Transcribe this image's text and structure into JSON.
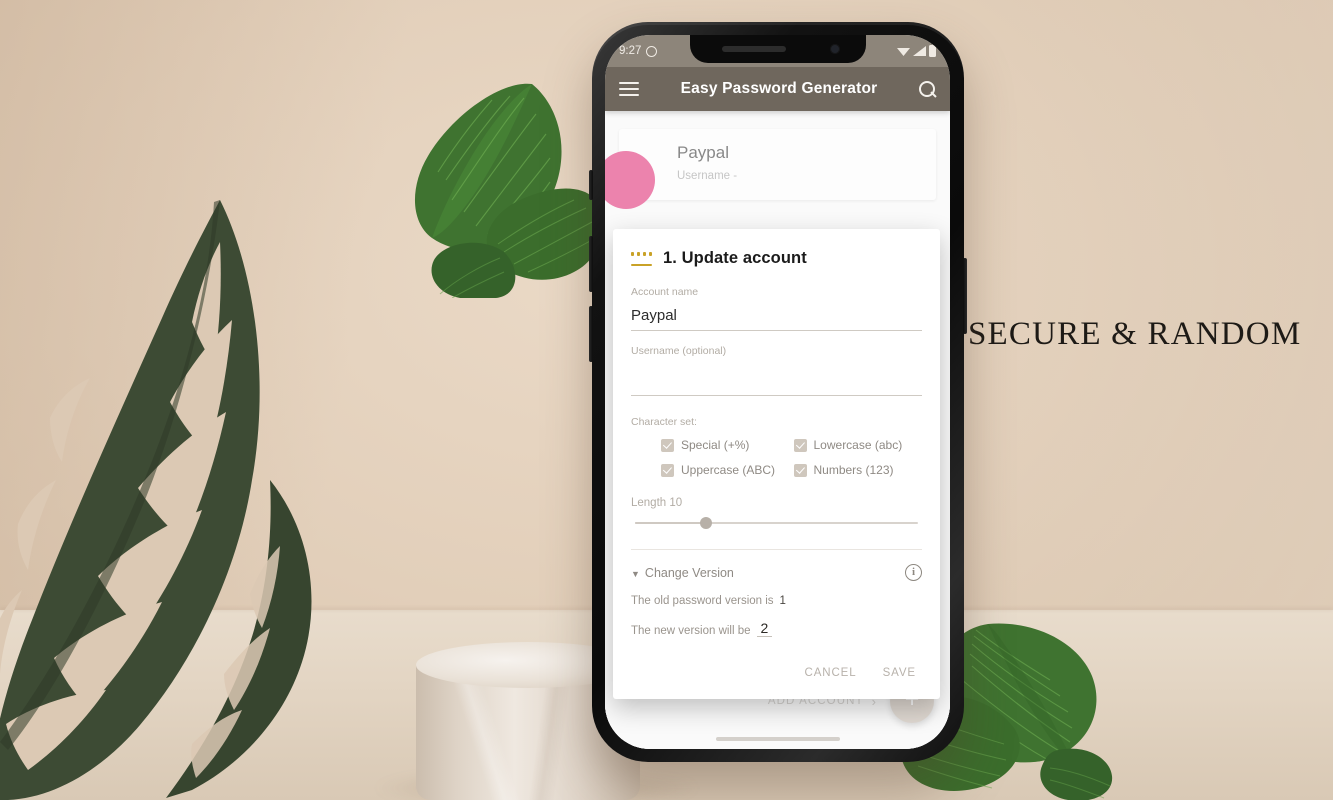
{
  "scene": {
    "headline": "SECURE & RANDOM",
    "background_color": "#e2cfba",
    "leaf_color": "#3f6b2e",
    "monstera_color": "#3c4a33"
  },
  "phone": {
    "status_bar": {
      "time": "9:27",
      "icons": [
        "alarm-icon",
        "wifi-icon",
        "signal-icon",
        "battery-icon"
      ]
    },
    "app_bar": {
      "menu_icon": "hamburger-icon",
      "title": "Easy Password Generator",
      "search_icon": "search-icon"
    },
    "list": {
      "items": [
        {
          "title": "Paypal",
          "subtitle": "Username -"
        }
      ]
    },
    "bottom": {
      "add_account_label": "ADD ACCOUNT",
      "add_account_arrow": "›",
      "fab_label": "+"
    }
  },
  "dialog": {
    "icon": "password-dots-icon",
    "title": "1. Update account",
    "account_name": {
      "label": "Account name",
      "value": "Paypal"
    },
    "username": {
      "label": "Username (optional)",
      "value": ""
    },
    "character_set": {
      "label": "Character set:",
      "options": [
        {
          "label": "Special (+%)",
          "checked": true
        },
        {
          "label": "Lowercase (abc)",
          "checked": true
        },
        {
          "label": "Uppercase (ABC)",
          "checked": true
        },
        {
          "label": "Numbers (123)",
          "checked": true
        }
      ]
    },
    "length": {
      "label": "Length 10",
      "value": 10,
      "min": 4,
      "max": 32,
      "thumb_percent": 25
    },
    "version": {
      "toggle_caret": "▼",
      "toggle_label": "Change Version",
      "info_icon": "info-icon",
      "info_glyph": "i",
      "old_text": "The old password version is",
      "old_value": "1",
      "new_text": "The new version will be",
      "new_value": "2"
    },
    "actions": {
      "cancel": "CANCEL",
      "save": "SAVE"
    }
  }
}
